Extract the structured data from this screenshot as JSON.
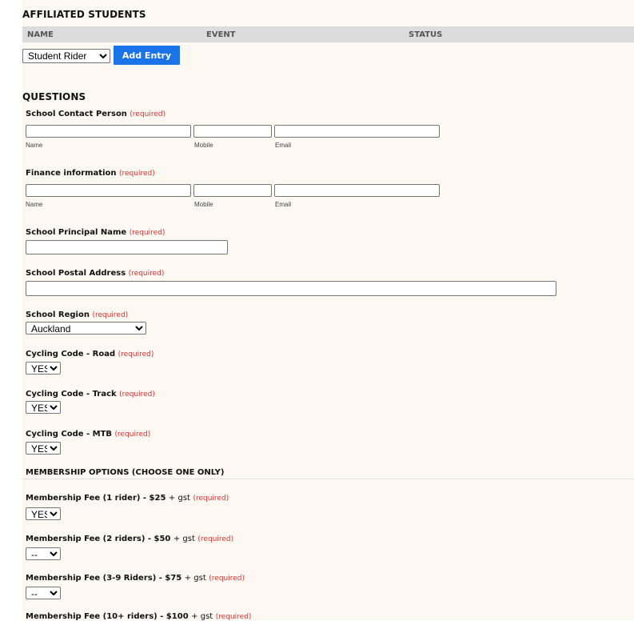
{
  "affiliated": {
    "title": "AFFILIATED STUDENTS",
    "columns": [
      "NAME",
      "EVENT",
      "STATUS"
    ],
    "select_value": "Student Rider",
    "add_button": "Add Entry"
  },
  "questions": {
    "title": "QUESTIONS",
    "required_text": "(required)",
    "contact": {
      "label": "School Contact Person",
      "name_sub": "Name",
      "mobile_sub": "Mobile",
      "email_sub": "Email"
    },
    "finance": {
      "label": "Finance information",
      "name_sub": "Name",
      "mobile_sub": "Mobile",
      "email_sub": "Email"
    },
    "principal": {
      "label": "School Principal Name"
    },
    "postal": {
      "label": "School Postal Address"
    },
    "region": {
      "label": "School Region",
      "value": "Auckland"
    },
    "code_road": {
      "label": "Cycling Code - Road",
      "value": "YES"
    },
    "code_track": {
      "label": "Cycling Code - Track",
      "value": "YES"
    },
    "code_mtb": {
      "label": "Cycling Code - MTB",
      "value": "YES"
    }
  },
  "membership": {
    "title": "MEMBERSHIP OPTIONS (CHOOSE ONE ONLY)",
    "fee1": {
      "label": "Membership Fee (1 rider) - $25",
      "suffix": "+ gst",
      "value": "YES"
    },
    "fee2": {
      "label": "Membership Fee (2 riders) - $50",
      "suffix": "+ gst",
      "value": "--"
    },
    "fee3": {
      "label": "Membership Fee (3-9 Riders) - $75",
      "suffix": "+ gst",
      "value": "--"
    },
    "fee4": {
      "label": "Membership Fee (10+ riders) - $100",
      "suffix": "+ gst"
    }
  }
}
